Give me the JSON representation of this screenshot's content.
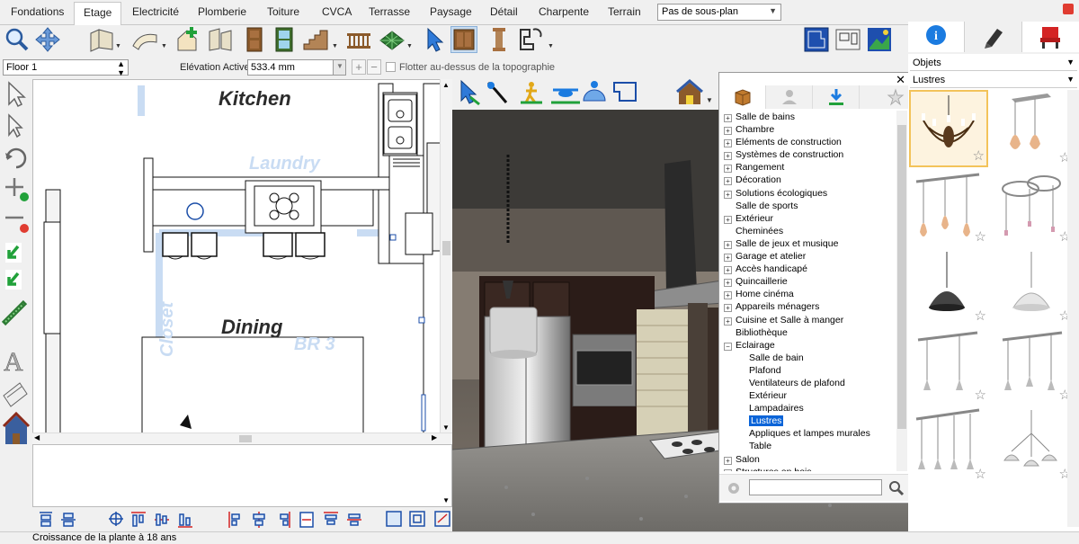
{
  "tabs": [
    "Fondations",
    "Etage",
    "Electricité",
    "Plomberie",
    "Toiture",
    "CVCA",
    "Terrasse",
    "Paysage",
    "Détail",
    "Charpente",
    "Terrain"
  ],
  "active_tab": "Etage",
  "plan_select": "Pas de sous-plan",
  "floor": "Floor 1",
  "elevation_label": "Elévation Active:",
  "elevation_value": "533.4 mm",
  "float_label": "Flotter au-dessus de la topographie",
  "rooms": {
    "kitchen": "Kitchen",
    "dining": "Dining",
    "laundry": "Laundry",
    "closet": "Closet",
    "br3": "BR 3"
  },
  "status": "Croissance de la plante à 18 ans",
  "catalog": {
    "tree": [
      {
        "label": "Salle de bains",
        "expandable": true
      },
      {
        "label": "Chambre",
        "expandable": true
      },
      {
        "label": "Eléments de construction",
        "expandable": true
      },
      {
        "label": "Systèmes de construction",
        "expandable": true
      },
      {
        "label": "Rangement",
        "expandable": true
      },
      {
        "label": "Décoration",
        "expandable": true
      },
      {
        "label": "Solutions écologiques",
        "expandable": true
      },
      {
        "label": "Salle de sports",
        "expandable": false
      },
      {
        "label": "Extérieur",
        "expandable": true
      },
      {
        "label": "Cheminées",
        "expandable": false
      },
      {
        "label": "Salle de jeux et musique",
        "expandable": true
      },
      {
        "label": "Garage et atelier",
        "expandable": true
      },
      {
        "label": "Accès handicapé",
        "expandable": true
      },
      {
        "label": "Quincaillerie",
        "expandable": true
      },
      {
        "label": "Home cinéma",
        "expandable": true
      },
      {
        "label": "Appareils ménagers",
        "expandable": true
      },
      {
        "label": "Cuisine et Salle à manger",
        "expandable": true
      },
      {
        "label": "Bibliothèque",
        "expandable": false
      },
      {
        "label": "Eclairage",
        "expandable": true,
        "expanded": true,
        "children": [
          "Salle de bain",
          "Plafond",
          "Ventilateurs de plafond",
          "Extérieur",
          "Lampadaires",
          "Lustres",
          "Appliques et lampes murales",
          "Table"
        ],
        "selected_child": "Lustres"
      },
      {
        "label": "Salon",
        "expandable": true
      },
      {
        "label": "Structures en bois",
        "expandable": true
      }
    ]
  },
  "objects": {
    "category": "Objets",
    "subcategory": "Lustres",
    "thumbnail_count": 10
  },
  "colors": {
    "accent": "#0a64d8",
    "selection": "#f3c35a",
    "plan_ghost": "#c9dcf3",
    "green": "#21a13a",
    "red": "#e03c31"
  },
  "icons": [
    "zoom-icon",
    "pan-icon",
    "select-arrow-icon",
    "info-icon",
    "pen-icon",
    "chair-icon",
    "search-icon",
    "gear-icon",
    "star-icon",
    "box-icon",
    "user-icon",
    "download-icon"
  ]
}
